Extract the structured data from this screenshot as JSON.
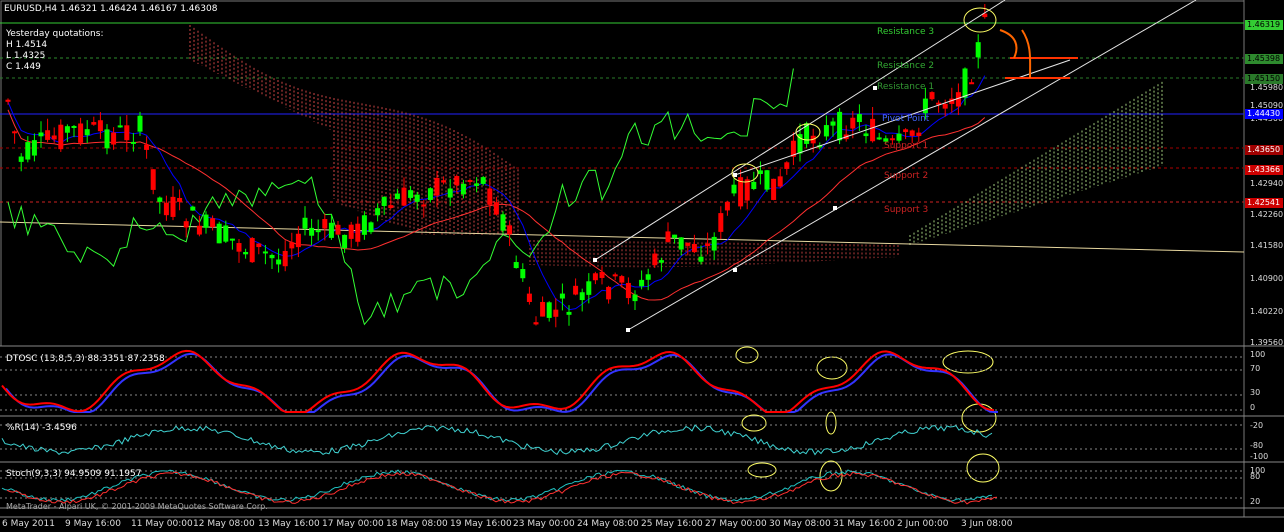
{
  "header": {
    "title": "EURUSD,H4  1.46321 1.46424 1.46167 1.46308",
    "yesterday_title": "Yesterday quotations:",
    "high": "H 1.4514",
    "low": "L 1.4325",
    "close": "C 1.449"
  },
  "levels": {
    "r3": "Resistance 3",
    "r2": "Resistance 2",
    "r1": "Resistance 1",
    "pivot": "Pivot Point",
    "s1": "Support 1",
    "s2": "Support 2",
    "s3": "Support 3"
  },
  "price_axis": {
    "labels": [
      "1.45980",
      "1.45090",
      "1.44300",
      "1.42940",
      "1.42260",
      "1.41580",
      "1.40900",
      "1.40220",
      "1.39560"
    ],
    "tags": [
      "1.46319",
      "1.45398",
      "1.45150",
      "1.44430",
      "1.43650",
      "1.43366",
      "1.42541"
    ]
  },
  "indicators": {
    "dtosc": {
      "label": "DTOSC (13,8,5,3) 88.3351 87.2358",
      "ticks": [
        "100",
        "70",
        "30",
        "0"
      ]
    },
    "wpr": {
      "label": "%R(14) -3.4596",
      "ticks": [
        "-20",
        "-80",
        "-100"
      ]
    },
    "stoch": {
      "label": "Stoch(9,3,3) 94.9509 91.1957",
      "ticks": [
        "100",
        "80",
        "20"
      ]
    }
  },
  "footer": {
    "watermark": "MetaTrader - Alpari UK, © 2001-2009 MetaQuotes Software Corp.",
    "dates": [
      "6 May 2011",
      "9 May 16:00",
      "11 May 00:00",
      "12 May 08:00",
      "13 May 16:00",
      "17 May 00:00",
      "18 May 08:00",
      "19 May 16:00",
      "23 May 00:00",
      "24 May 08:00",
      "25 May 16:00",
      "27 May 00:00",
      "30 May 08:00",
      "31 May 16:00",
      "2 Jun 00:00",
      "3 Jun 08:00"
    ]
  },
  "colors": {
    "bull": "#00ff00",
    "bear": "#ff0000",
    "tenkan": "#0000ff",
    "kijun": "#ff3030",
    "chikou": "#33ff33",
    "kumo_bear": "#ff5555",
    "kumo_bull": "#c8ff9a",
    "channel": "#e6e6e6",
    "annotation": "#ff6600",
    "ellipse": "#ffff66",
    "dtosc_fast": "#ff0000",
    "dtosc_slow": "#3333ff",
    "wpr": "#3fd2d2"
  }
}
